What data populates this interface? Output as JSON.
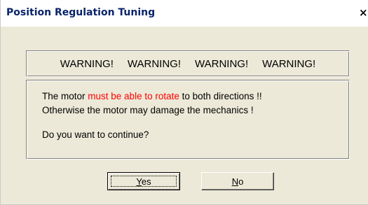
{
  "window": {
    "title": "Position Regulation Tuning",
    "close_label": "×"
  },
  "warning": {
    "items": [
      "WARNING!",
      "WARNING!",
      "WARNING!",
      "WARNING!"
    ]
  },
  "message": {
    "line1_prefix": "The motor ",
    "line1_highlight": "must be able to rotate",
    "line1_suffix": " to both directions !!",
    "line2": "Otherwise the motor may damage the mechanics !",
    "question": "Do you want to continue?",
    "highlight_color": "#ff0000"
  },
  "buttons": {
    "yes_mnemonic": "Y",
    "yes_rest": "es",
    "no_mnemonic": "N",
    "no_rest": "o"
  },
  "icons": {
    "close": "close-icon"
  }
}
